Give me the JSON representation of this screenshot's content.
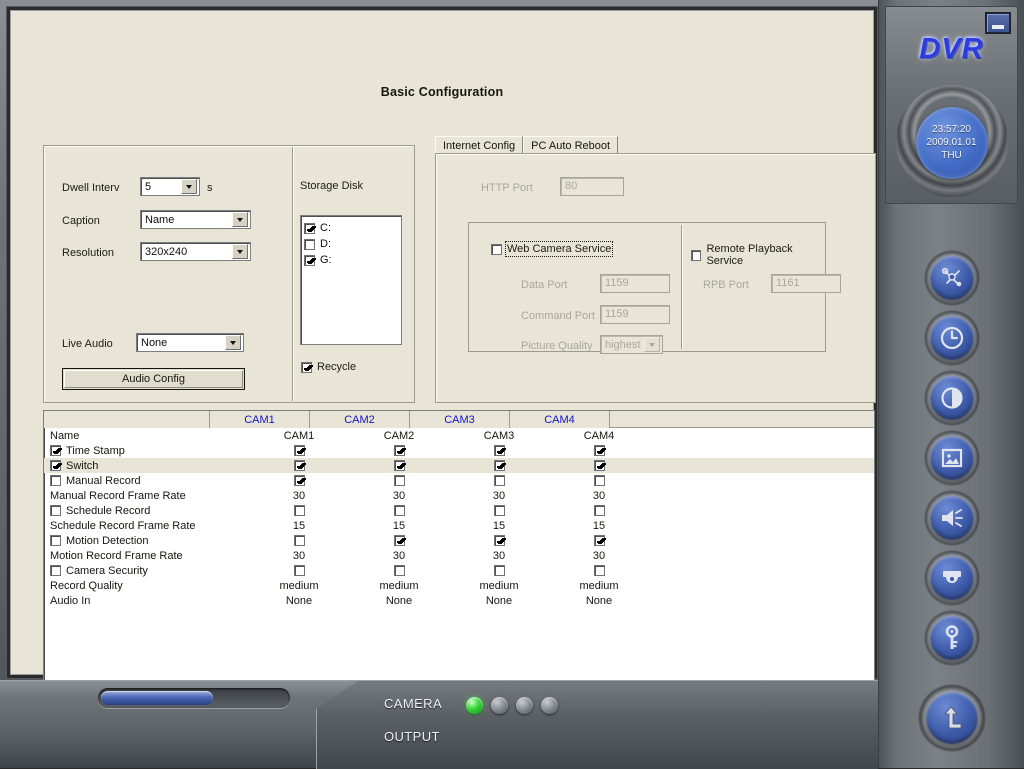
{
  "window": {
    "title": "DVR",
    "page_title": "Basic Configuration",
    "minimize_label": "_"
  },
  "clock": {
    "time": "23:57:20",
    "date": "2009.01.01",
    "weekday": "THU"
  },
  "basic": {
    "dwell_label": "Dwell Interv",
    "dwell_value": "5",
    "dwell_unit": "s",
    "caption_label": "Caption",
    "caption_value": "Name",
    "resolution_label": "Resolution",
    "resolution_value": "320x240",
    "live_audio_label": "Live Audio",
    "live_audio_value": "None",
    "audio_config_button": "Audio Config"
  },
  "storage": {
    "title": "Storage Disk",
    "disks": [
      {
        "label": "C:",
        "checked": true
      },
      {
        "label": "D:",
        "checked": false
      },
      {
        "label": "G:",
        "checked": true
      }
    ],
    "recycle_label": "Recycle",
    "recycle_checked": true
  },
  "tabs": [
    {
      "label": "Internet Config",
      "active": true
    },
    {
      "label": "PC Auto Reboot",
      "active": false
    }
  ],
  "internet": {
    "http_port_label": "HTTP Port",
    "http_port_value": "80",
    "web_camera_service_label": "Web Camera Service",
    "web_camera_service_checked": false,
    "data_port_label": "Data Port",
    "data_port_value": "1159",
    "command_port_label": "Command Port",
    "command_port_value": "1159",
    "picture_quality_label": "Picture Quality",
    "picture_quality_value": "highest",
    "remote_playback_label": "Remote Playback Service",
    "remote_playback_checked": false,
    "rpb_port_label": "RPB Port",
    "rpb_port_value": "1161"
  },
  "camera_table": {
    "columns": [
      "",
      "CAM1",
      "CAM2",
      "CAM3",
      "CAM4"
    ],
    "rows": [
      {
        "label": "Name",
        "type": "text",
        "has_row_checkbox": false,
        "indent": false,
        "selected": false,
        "values": [
          "CAM1",
          "CAM2",
          "CAM3",
          "CAM4"
        ]
      },
      {
        "label": "Time Stamp",
        "type": "check",
        "has_row_checkbox": true,
        "row_checked": true,
        "indent": true,
        "selected": false,
        "values": [
          true,
          true,
          true,
          true
        ]
      },
      {
        "label": "Switch",
        "type": "check",
        "has_row_checkbox": true,
        "row_checked": true,
        "indent": true,
        "selected": true,
        "values": [
          true,
          true,
          true,
          true
        ]
      },
      {
        "label": "Manual Record",
        "type": "check",
        "has_row_checkbox": true,
        "row_checked": false,
        "indent": true,
        "selected": false,
        "values": [
          true,
          false,
          false,
          false
        ]
      },
      {
        "label": "Manual Record Frame Rate",
        "type": "text",
        "has_row_checkbox": false,
        "indent": false,
        "selected": false,
        "values": [
          "30",
          "30",
          "30",
          "30"
        ]
      },
      {
        "label": "Schedule Record",
        "type": "check",
        "has_row_checkbox": true,
        "row_checked": false,
        "indent": true,
        "selected": false,
        "values": [
          false,
          false,
          false,
          false
        ]
      },
      {
        "label": "Schedule Record Frame Rate",
        "type": "text",
        "has_row_checkbox": false,
        "indent": false,
        "selected": false,
        "values": [
          "15",
          "15",
          "15",
          "15"
        ]
      },
      {
        "label": "Motion Detection",
        "type": "check",
        "has_row_checkbox": true,
        "row_checked": false,
        "indent": true,
        "selected": false,
        "values": [
          false,
          true,
          true,
          true
        ]
      },
      {
        "label": "Motion Record Frame Rate",
        "type": "text",
        "has_row_checkbox": false,
        "indent": false,
        "selected": false,
        "values": [
          "30",
          "30",
          "30",
          "30"
        ]
      },
      {
        "label": "Camera Security",
        "type": "check",
        "has_row_checkbox": true,
        "row_checked": false,
        "indent": true,
        "selected": false,
        "values": [
          false,
          false,
          false,
          false
        ]
      },
      {
        "label": "Record Quality",
        "type": "text",
        "has_row_checkbox": false,
        "indent": false,
        "selected": false,
        "values": [
          "medium",
          "medium",
          "medium",
          "medium"
        ]
      },
      {
        "label": "Audio In",
        "type": "text",
        "has_row_checkbox": false,
        "indent": false,
        "selected": false,
        "values": [
          "None",
          "None",
          "None",
          "None"
        ]
      }
    ]
  },
  "sidebar_buttons": [
    {
      "icon": "tools-icon",
      "name": "configuration"
    },
    {
      "icon": "clock-icon",
      "name": "schedule"
    },
    {
      "icon": "contrast-icon",
      "name": "display-adjust"
    },
    {
      "icon": "image-icon",
      "name": "snapshot"
    },
    {
      "icon": "speaker-icon",
      "name": "audio"
    },
    {
      "icon": "dome-camera-icon",
      "name": "ptz"
    },
    {
      "icon": "key-icon",
      "name": "security"
    }
  ],
  "exit_button": {
    "icon": "exit-arrow-icon"
  },
  "status": {
    "camera_label": "CAMERA",
    "output_label": "OUTPUT",
    "camera_leds": [
      true,
      false,
      false,
      false
    ]
  },
  "colors": {
    "accent_blue": "#1414c8",
    "panel_bg": "#e8e5d6",
    "logo_blue": "#2b3ce0",
    "led_green": "#35d435"
  }
}
